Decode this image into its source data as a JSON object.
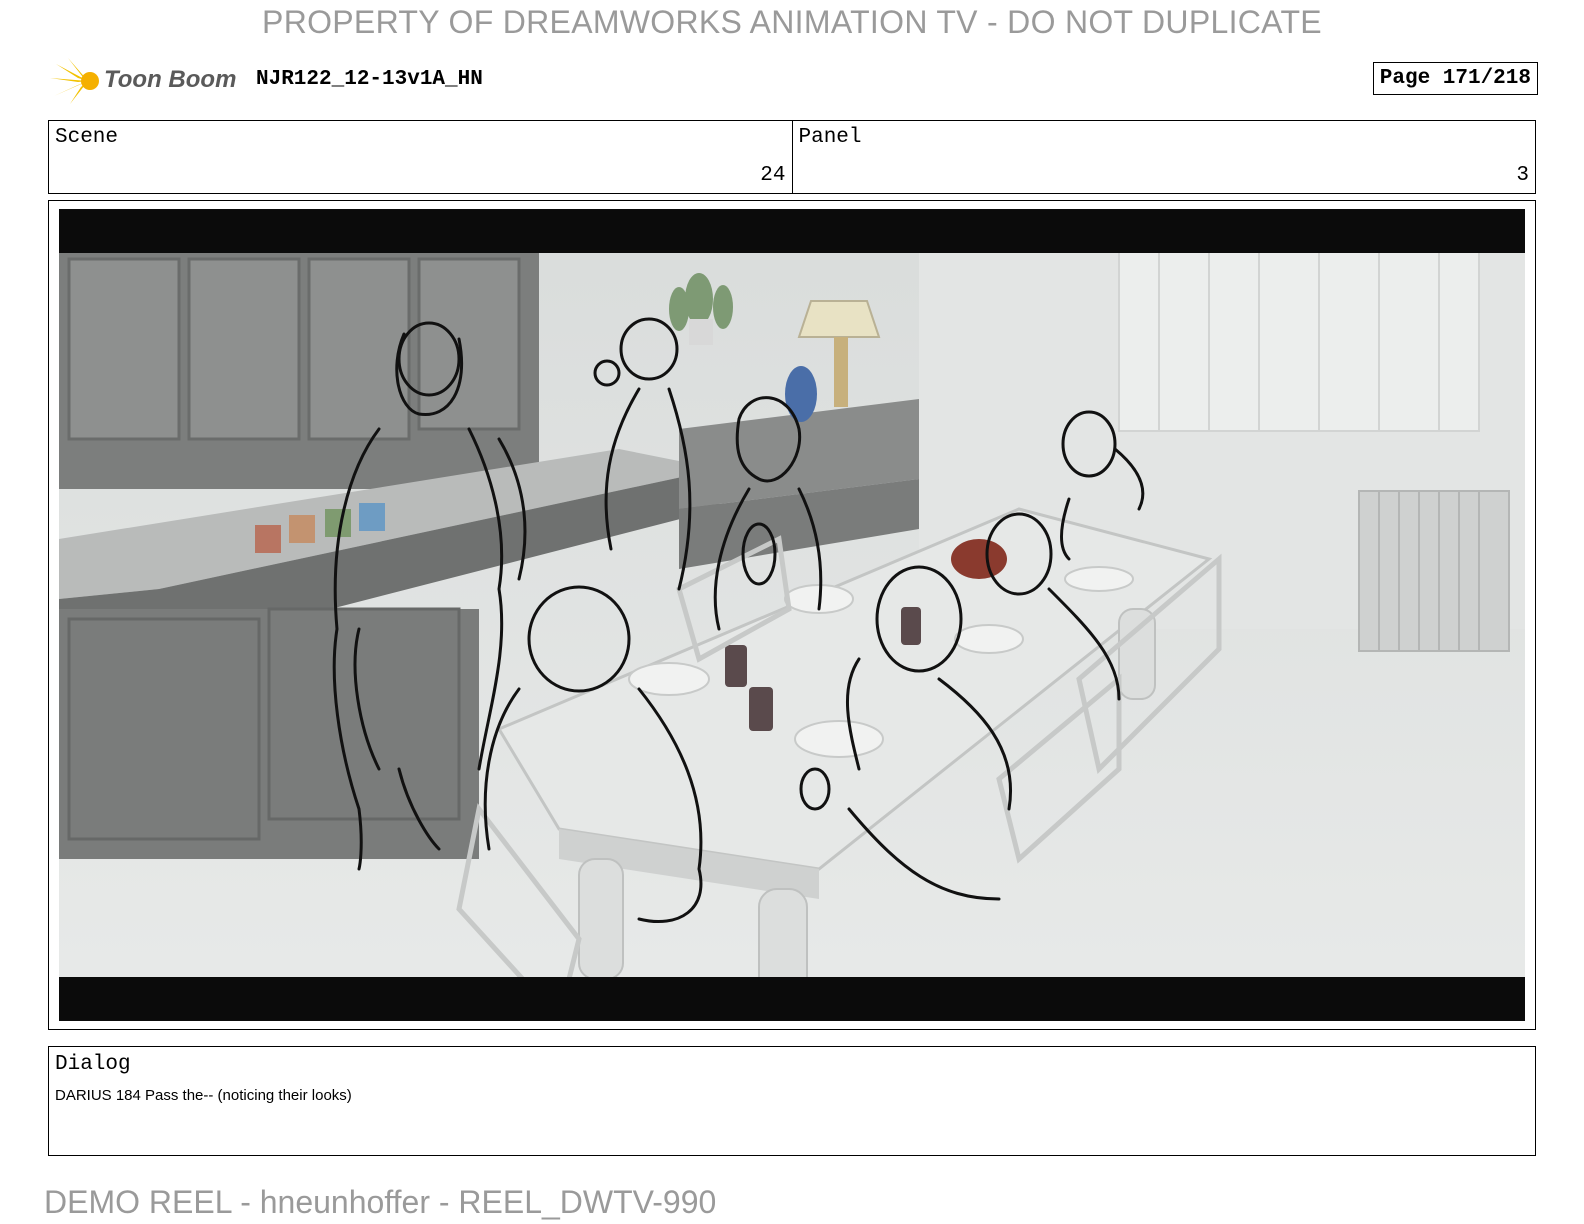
{
  "watermark_top": "PROPERTY OF DREAMWORKS ANIMATION TV - DO NOT DUPLICATE",
  "header": {
    "logo_text": "Toon Boom",
    "doc_id": "NJR122_12-13v1A_HN",
    "page_label": "Page 171/218"
  },
  "info": {
    "scene_label": "Scene",
    "scene_value": "24",
    "panel_label": "Panel",
    "panel_value": "3"
  },
  "dialog": {
    "label": "Dialog",
    "text": "DARIUS 184 Pass the--  (noticing their looks)"
  },
  "watermark_bottom": "DEMO REEL - hneunhoffer - REEL_DWTV-990"
}
